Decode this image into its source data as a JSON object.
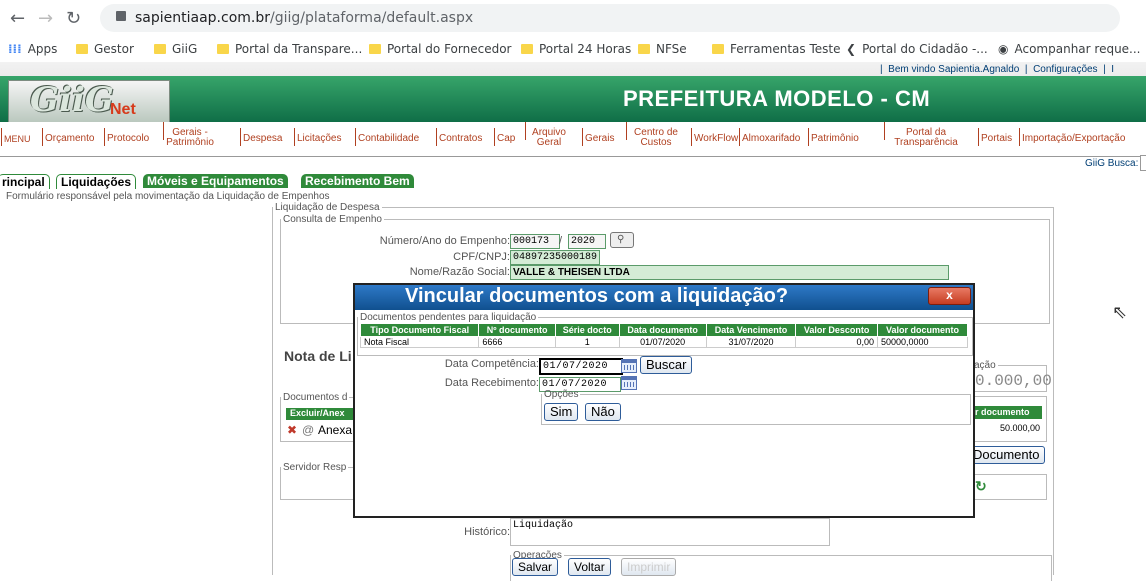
{
  "browser": {
    "url_host": "sapientiaap.com.br",
    "url_path": "/giig/plataforma/default.aspx",
    "bookmarks": [
      "Apps",
      "Gestor",
      "GiiG",
      "Portal da Transpare...",
      "Portal do Fornecedor",
      "Portal 24 Horas",
      "NFSe",
      "Ferramentas Teste",
      "Portal do Cidadão -...",
      "Acompanhar reque..."
    ]
  },
  "header": {
    "welcome": "Bem vindo Sapientia.Agnaldo",
    "config": "Configurações",
    "logo_main": "GiiG",
    "logo_sub": "Net",
    "title": "PREFEITURA MODELO - CM",
    "busca": "GiiG Busca:"
  },
  "menu": [
    "MENU",
    "Orçamento",
    "Protocolo",
    "Gerais - Patrimônio",
    "Despesa",
    "Licitações",
    "Contabilidade",
    "Contratos",
    "Cap",
    "Arquivo Geral",
    "Gerais",
    "Centro de Custos",
    "WorkFlow",
    "Almoxarifado",
    "Patrimônio",
    "Portal da Transparência",
    "Portais",
    "Importação/Exportação"
  ],
  "tabs": [
    "rincipal",
    "Liquidações",
    "Móveis e Equipamentos",
    "Recebimento Bem"
  ],
  "form": {
    "description": "Formulário responsável pela movimentação da Liquidação de Empenhos",
    "legend_liq": "Liquidação de Despesa",
    "legend_consulta": "Consulta de Empenho",
    "numero_label": "Número/Ano do Empenho:",
    "numero_value": "000173",
    "sep": "/",
    "ano_value": "2020",
    "cpf_label": "CPF/CNPJ:",
    "cpf_value": "04897235000189",
    "nome_label": "Nome/Razão Social:",
    "nome_value": "VALLE & THEISEN LTDA",
    "nota_partial": "Nota de Li",
    "docs_partial": "Documentos d",
    "excluir_partial": "Excluir/Anex",
    "anexa_partial": "Anexa",
    "servidor_partial": "Servidor Resp",
    "right_legend_partial": "ação",
    "right_value_partial": "0.000,00",
    "right_header_partial": "r documento",
    "right_cell_value": "50.000,00",
    "right_button_partial": "Documento",
    "historico_label": "Histórico:",
    "historico_value": "Liquidação",
    "operacoes_legend": "Operações",
    "salvar": "Salvar",
    "voltar": "Voltar",
    "imprimir": "Imprimir"
  },
  "modal": {
    "title": "Vincular documentos com a liquidação?",
    "close": "x",
    "legend_pendentes": "Documentos pendentes para liquidação",
    "columns": [
      "Tipo Documento Fiscal",
      "Nº documento",
      "Série docto",
      "Data documento",
      "Data Vencimento",
      "Valor Desconto",
      "Valor documento"
    ],
    "rows": [
      [
        "Nota Fiscal",
        "6666",
        "1",
        "01/07/2020",
        "31/07/2020",
        "0,00",
        "50000,0000"
      ]
    ],
    "competencia_label": "Data Competência:",
    "competencia_value": "01/07/2020",
    "buscar": "Buscar",
    "recebimento_label": "Data Recebimento:",
    "recebimento_value": "01/07/2020",
    "opcoes_legend": "Opções",
    "sim": "Sim",
    "nao": "Não"
  }
}
